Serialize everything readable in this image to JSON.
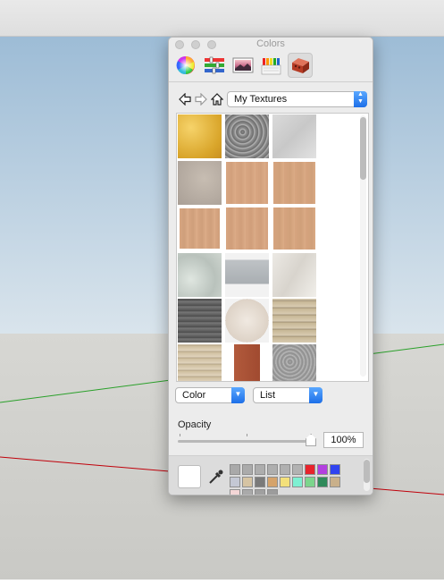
{
  "panel": {
    "title": "Colors",
    "modes": [
      {
        "name": "color-wheel",
        "icon": "color-wheel-icon"
      },
      {
        "name": "color-sliders",
        "icon": "sliders-icon"
      },
      {
        "name": "image-palettes",
        "icon": "image-palette-icon"
      },
      {
        "name": "crayons",
        "icon": "crayons-icon"
      },
      {
        "name": "textures",
        "icon": "brick-icon",
        "selected": true
      }
    ],
    "library": "My Textures",
    "display_popup": "Color",
    "view_popup": "List",
    "opacity_label": "Opacity",
    "opacity_value": "100%",
    "opacity_fraction": 1.0
  },
  "colors": {
    "accent": "#1d6fe8",
    "sky": "#b9d0e1",
    "ground": "#d4d4d0",
    "axis_red": "#c0000a",
    "axis_green": "#2aa02a"
  }
}
